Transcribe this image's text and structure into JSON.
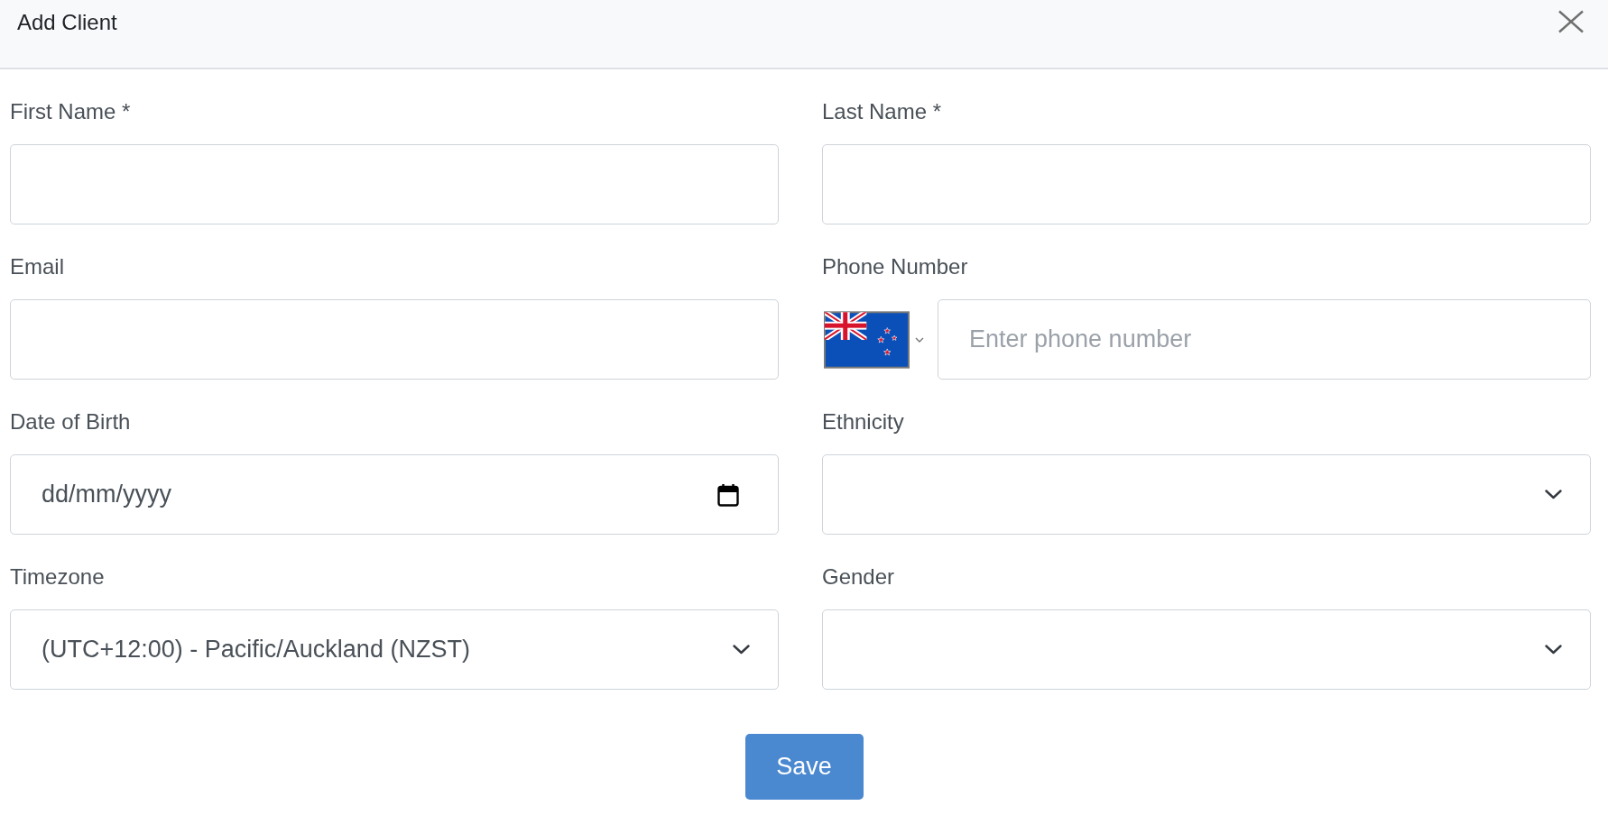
{
  "dialog": {
    "title": "Add Client"
  },
  "fields": [
    {
      "label": "First Name *",
      "kind": "text"
    },
    {
      "label": "Last Name *",
      "kind": "text"
    },
    {
      "label": "Email",
      "kind": "text"
    },
    {
      "label": "Phone Number",
      "kind": "phone",
      "placeholder": "Enter phone number"
    },
    {
      "label": "Date of Birth",
      "kind": "date",
      "placeholder": "dd/mm/yyyy"
    },
    {
      "label": "Ethnicity",
      "kind": "select"
    },
    {
      "label": "Timezone",
      "kind": "select",
      "value": "(UTC+12:00) - Pacific/Auckland (NZST)"
    },
    {
      "label": "Gender",
      "kind": "select"
    }
  ],
  "save_button": {
    "label": "Save"
  }
}
